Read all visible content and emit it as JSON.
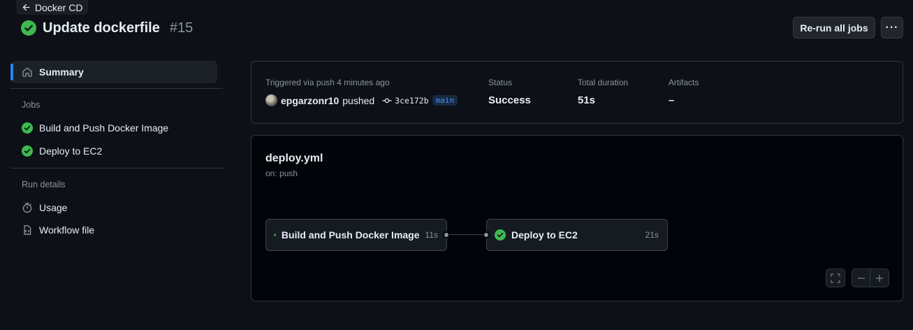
{
  "header": {
    "back_label": "Docker CD",
    "title": "Update dockerfile",
    "run_number": "#15",
    "rerun_label": "Re-run all jobs",
    "more_label": "···"
  },
  "sidebar": {
    "summary_label": "Summary",
    "jobs_heading": "Jobs",
    "jobs": [
      {
        "label": "Build and Push Docker Image"
      },
      {
        "label": "Deploy to EC2"
      }
    ],
    "run_details_heading": "Run details",
    "usage_label": "Usage",
    "workflow_file_label": "Workflow file"
  },
  "summary": {
    "trigger_text": "Triggered via push 4 minutes ago",
    "actor": "epgarzonr10",
    "action": "pushed",
    "commit_sha": "3ce172b",
    "branch": "main",
    "status_label": "Status",
    "status_value": "Success",
    "duration_label": "Total duration",
    "duration_value": "51s",
    "artifacts_label": "Artifacts",
    "artifacts_value": "–"
  },
  "workflow": {
    "file": "deploy.yml",
    "trigger": "on: push",
    "jobs": [
      {
        "name": "Build and Push Docker Image",
        "duration": "11s"
      },
      {
        "name": "Deploy to EC2",
        "duration": "21s"
      }
    ]
  },
  "colors": {
    "success": "#3fb950",
    "accent": "#2f81f7",
    "background": "#0d1117"
  }
}
